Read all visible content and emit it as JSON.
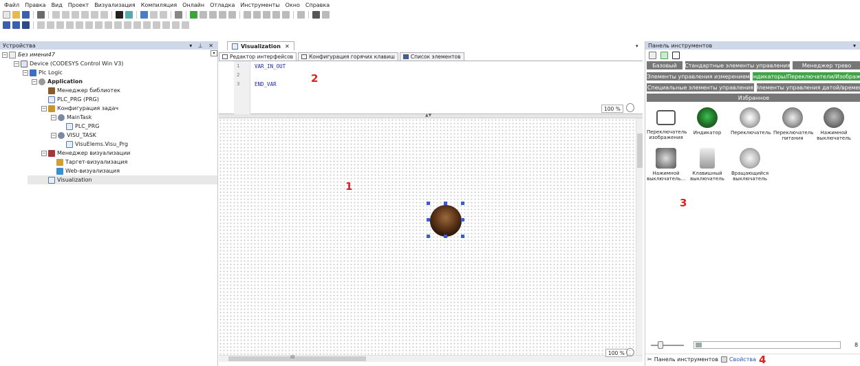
{
  "menu": [
    "Файл",
    "Правка",
    "Вид",
    "Проект",
    "Визуализация",
    "Компиляция",
    "Онлайн",
    "Отладка",
    "Инструменты",
    "Окно",
    "Справка"
  ],
  "devices_panel": {
    "title": "Устройства",
    "controls": "▾ ⊥ ✕",
    "tree": [
      {
        "label": "Без имени47",
        "italic": true
      },
      {
        "label": "Device (CODESYS Control Win V3)"
      },
      {
        "label": "Plc Logic"
      },
      {
        "label": "Application",
        "bold": true
      },
      {
        "label": "Менеджер библиотек"
      },
      {
        "label": "PLC_PRG (PRG)"
      },
      {
        "label": "Конфигурация задач"
      },
      {
        "label": "MainTask"
      },
      {
        "label": "PLC_PRG"
      },
      {
        "label": "VISU_TASK"
      },
      {
        "label": "VisuElems.Visu_Prg"
      },
      {
        "label": "Менеджер визуализации"
      },
      {
        "label": "Таргет-визуализация"
      },
      {
        "label": "Web-визуализация"
      },
      {
        "label": "Visualization"
      }
    ]
  },
  "editor": {
    "doc_tab": "Visualization",
    "doc_tab_close": "✕",
    "sub_tabs": [
      "Редактор интерфейсов",
      "Конфигурация горячих клавиш",
      "Список элементов"
    ],
    "code_lines": [
      {
        "num": "1",
        "text": "VAR_IN_OUT"
      },
      {
        "num": "2",
        "text": ""
      },
      {
        "num": "3",
        "text": "END_VAR"
      }
    ],
    "zoom_top": "100 %",
    "zoom_bottom": "100 %",
    "hscroll_mark": "III"
  },
  "toolbox": {
    "title": "Панель инструментов",
    "row1": [
      "Базовый",
      "Стандартные элементы управления",
      "Менеджер трево"
    ],
    "row2": [
      "Элементы управления измерением",
      "Индикаторы/Переключатели/Изображе"
    ],
    "row3": [
      "Специальные элементы управления",
      "Элементы управления датой/времен"
    ],
    "row4": "Избранное",
    "items": [
      {
        "label": "Переключатель изображения"
      },
      {
        "label": "Индикатор"
      },
      {
        "label": "Переключатель"
      },
      {
        "label": "Переключатель питания"
      },
      {
        "label": "Нажимной выключатель"
      },
      {
        "label": "Нажимной выключатель..."
      },
      {
        "label": "Клавишный выключатель"
      },
      {
        "label": "Вращающийся выключатель"
      }
    ],
    "slider_end": "8",
    "bottom_tabs": [
      "Панель инструментов",
      "Свойства"
    ]
  },
  "annotations": [
    "1",
    "2",
    "3",
    "4"
  ],
  "colors": {
    "panel_title_bg": "#cfd8e8",
    "toolbox_btn_gray": "#777777",
    "toolbox_btn_green": "#3fa447",
    "annotation_red": "#e02020",
    "code_blue": "#1a24a8"
  }
}
